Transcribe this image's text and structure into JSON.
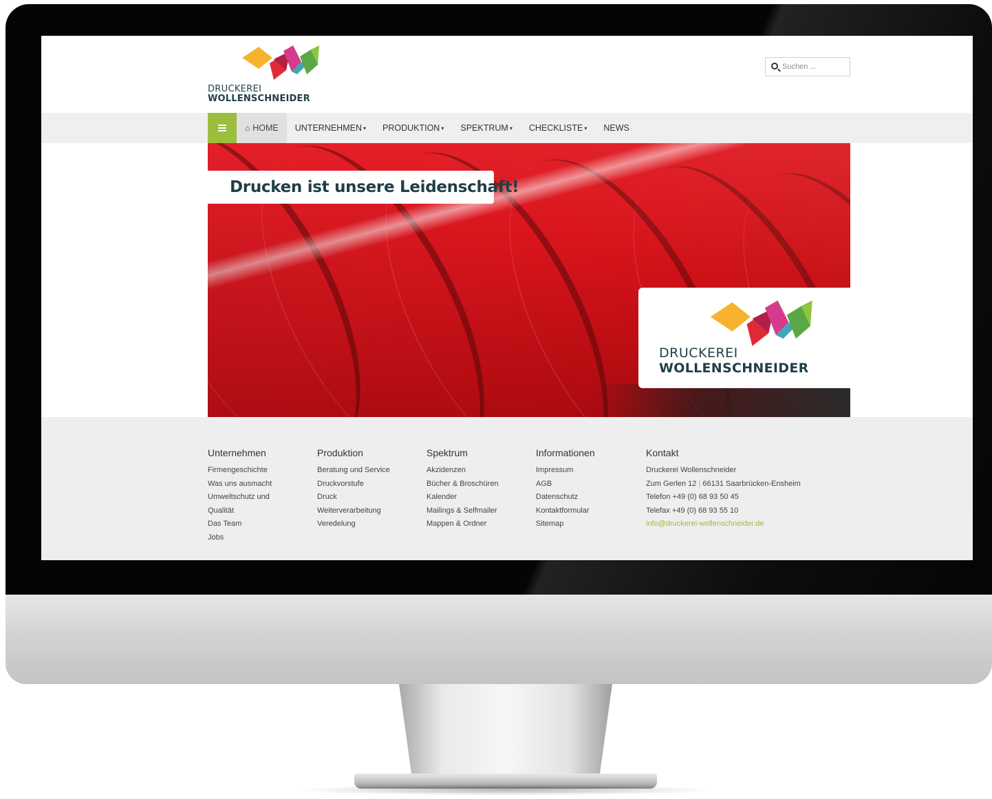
{
  "brand": {
    "line1": "DRUCKEREI",
    "line2": "WOLLENSCHNEIDER",
    "colors": {
      "yellow": "#f7b230",
      "red": "#e02a35",
      "magenta": "#d63a8c",
      "teal": "#3fa7b8",
      "green": "#5aa845",
      "navy": "#1f3f48",
      "accent": "#9bbf3d"
    }
  },
  "search": {
    "placeholder": "Suchen ..."
  },
  "nav": {
    "toggle_icon": "menu-icon",
    "home_icon": "home-icon",
    "items": [
      {
        "label": "HOME",
        "active": true
      },
      {
        "label": "UNTERNEHMEN",
        "dropdown": true
      },
      {
        "label": "PRODUKTION",
        "dropdown": true
      },
      {
        "label": "SPEKTRUM",
        "dropdown": true
      },
      {
        "label": "CHECKLISTE",
        "dropdown": true
      },
      {
        "label": "NEWS"
      }
    ]
  },
  "hero": {
    "headline": "Drucken ist unsere Leidenschaft!",
    "logo_line1": "DRUCKEREI",
    "logo_line2": "WOLLENSCHNEIDER"
  },
  "footer": {
    "columns": [
      {
        "title": "Unternehmen",
        "links": [
          "Firmengeschichte",
          "Was uns ausmacht",
          "Umweltschutz und Qualität",
          "Das Team",
          "Jobs"
        ]
      },
      {
        "title": "Produktion",
        "links": [
          "Beratung und Service",
          "Druckvorstufe",
          "Druck",
          "Weiterverarbeitung",
          "Veredelung"
        ]
      },
      {
        "title": "Spektrum",
        "links": [
          "Akzidenzen",
          "Bücher & Broschüren",
          "Kalender",
          "Mailings & Selfmailer",
          "Mappen & Ordner"
        ]
      },
      {
        "title": "Informationen",
        "links": [
          "Impressum",
          "AGB",
          "Datenschutz",
          "Kontaktformular",
          "Sitemap"
        ]
      }
    ],
    "contact": {
      "title": "Kontakt",
      "name": "Druckerei Wollenschneider",
      "street": "Zum Gerlen 12",
      "separator": "|",
      "city": "66131 Saarbrücken-Ensheim",
      "phone": "Telefon +49 (0) 68 93 50 45",
      "fax": "Telefax +49 (0) 68 93 55 10",
      "email": "info@druckerei-wollenschneider.de"
    }
  }
}
